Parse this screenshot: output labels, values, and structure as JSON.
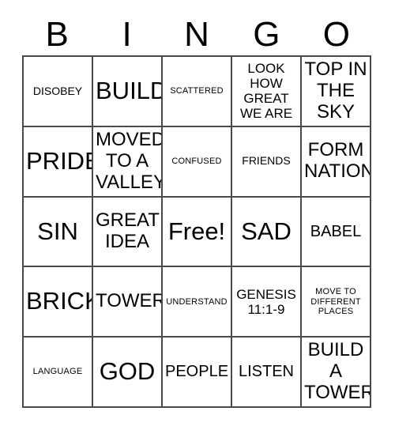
{
  "header": {
    "letters": [
      "B",
      "I",
      "N",
      "G",
      "O"
    ]
  },
  "grid": {
    "rows": 5,
    "columns": 5,
    "border_color": "#4a4a4a",
    "cell_background": "#ffffff",
    "text_color": "#000000",
    "cells": [
      {
        "text": "DISOBEY",
        "size": "sm"
      },
      {
        "text": "BUILD",
        "size": "xxl"
      },
      {
        "text": "SCATTERED",
        "size": "xs"
      },
      {
        "text": "LOOK\nHOW\nGREAT\nWE ARE",
        "size": "md"
      },
      {
        "text": "TOP IN\nTHE\nSKY",
        "size": "xl"
      },
      {
        "text": "PRIDE",
        "size": "xxl"
      },
      {
        "text": "MOVED\nTO A\nVALLEY",
        "size": "xl"
      },
      {
        "text": "CONFUSED",
        "size": "xs"
      },
      {
        "text": "FRIENDS",
        "size": "sm"
      },
      {
        "text": "FORM\nNATION",
        "size": "xl"
      },
      {
        "text": "SIN",
        "size": "xxl"
      },
      {
        "text": "GREAT\nIDEA",
        "size": "xl"
      },
      {
        "text": "Free!",
        "size": "free"
      },
      {
        "text": "SAD",
        "size": "xxl"
      },
      {
        "text": "BABEL",
        "size": "lg"
      },
      {
        "text": "BRICK",
        "size": "xxl"
      },
      {
        "text": "TOWER",
        "size": "xl"
      },
      {
        "text": "UNDERSTAND",
        "size": "xs"
      },
      {
        "text": "GENESIS\n11:1-9",
        "size": "md"
      },
      {
        "text": "MOVE TO\nDIFFERENT\nPLACES",
        "size": "xs"
      },
      {
        "text": "LANGUAGE",
        "size": "xs"
      },
      {
        "text": "GOD",
        "size": "xxl"
      },
      {
        "text": "PEOPLE",
        "size": "lg"
      },
      {
        "text": "LISTEN",
        "size": "lg"
      },
      {
        "text": "BUILD\nA\nTOWER",
        "size": "xl"
      }
    ]
  }
}
